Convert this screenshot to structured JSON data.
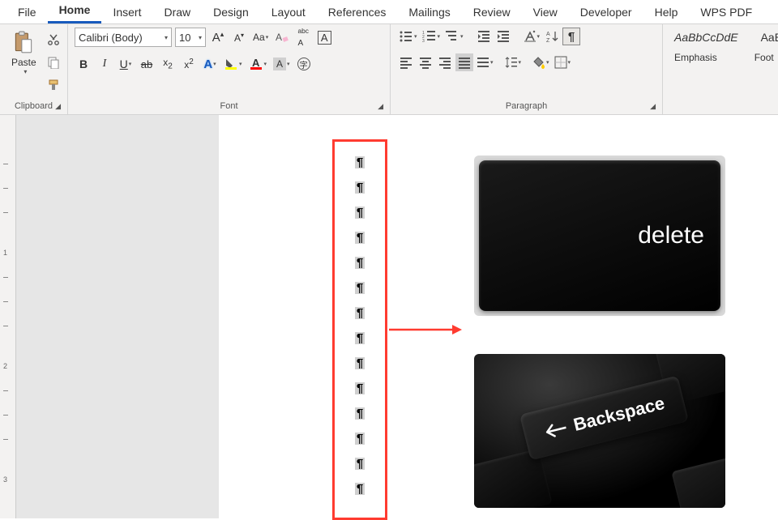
{
  "tabs": [
    "File",
    "Home",
    "Insert",
    "Draw",
    "Design",
    "Layout",
    "References",
    "Mailings",
    "Review",
    "View",
    "Developer",
    "Help",
    "WPS PDF"
  ],
  "active_tab": "Home",
  "clipboard": {
    "paste": "Paste",
    "label": "Clipboard"
  },
  "font": {
    "name": "Calibri (Body)",
    "size": "10",
    "label": "Font"
  },
  "paragraph": {
    "label": "Paragraph"
  },
  "styles": {
    "preview1": "AaBbCcDdE",
    "preview2": "AaBbCc",
    "name1": "Emphasis",
    "name2": "Foot"
  },
  "doc": {
    "pilcrow": "¶",
    "delete_label": "delete",
    "backspace_label": "Backspace"
  },
  "ruler": {
    "n1": "1",
    "n2": "2",
    "n3": "3"
  }
}
